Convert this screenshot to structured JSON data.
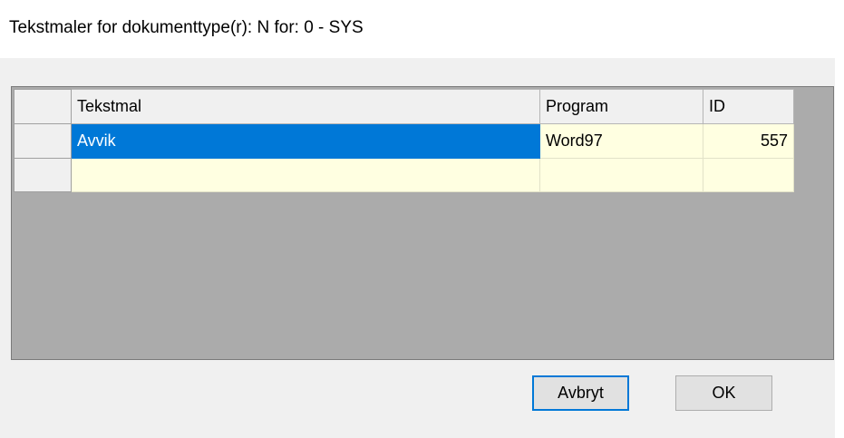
{
  "window": {
    "title": "Tekstmaler for dokumenttype(r): N for: 0 - SYS"
  },
  "grid": {
    "columns": [
      "Tekstmal",
      "Program",
      "ID"
    ],
    "rows": [
      {
        "tekstmal": "Avvik",
        "program": "Word97",
        "id": "557",
        "selected": true
      },
      {
        "tekstmal": "",
        "program": "",
        "id": "",
        "selected": false
      }
    ]
  },
  "buttons": {
    "cancel_label": "Avbryt",
    "ok_label": "OK"
  },
  "colors": {
    "selection": "#0078d7",
    "cell_background": "#ffffe1",
    "grid_background": "#ababab"
  }
}
